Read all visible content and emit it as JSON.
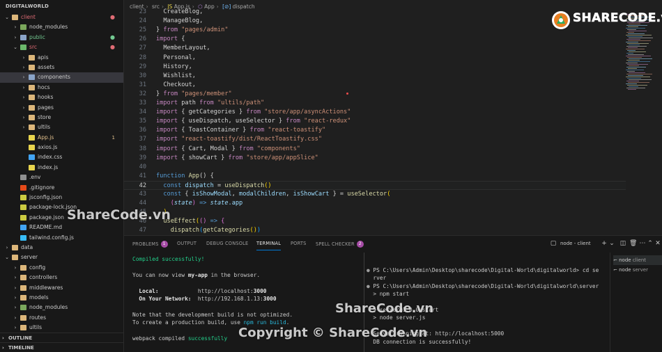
{
  "sidebar": {
    "header": "DIGITALWORLD",
    "items": [
      {
        "label": "client",
        "depth": 0,
        "chev": "⌄",
        "icon": "folder",
        "dot": "●",
        "color": "#e06c75"
      },
      {
        "label": "node_modules",
        "depth": 1,
        "chev": "›",
        "icon": "folder-node"
      },
      {
        "label": "public",
        "depth": 1,
        "chev": "›",
        "icon": "folder-special",
        "dot": "●",
        "color": "#73c991"
      },
      {
        "label": "src",
        "depth": 1,
        "chev": "⌄",
        "icon": "folder-src",
        "dot": "●",
        "color": "#e06c75"
      },
      {
        "label": "apis",
        "depth": 2,
        "chev": "›",
        "icon": "folder"
      },
      {
        "label": "assets",
        "depth": 2,
        "chev": "›",
        "icon": "folder"
      },
      {
        "label": "components",
        "depth": 2,
        "chev": "›",
        "icon": "folder-special",
        "selected": true
      },
      {
        "label": "hocs",
        "depth": 2,
        "chev": "›",
        "icon": "folder"
      },
      {
        "label": "hooks",
        "depth": 2,
        "chev": "›",
        "icon": "folder"
      },
      {
        "label": "pages",
        "depth": 2,
        "chev": "›",
        "icon": "folder"
      },
      {
        "label": "store",
        "depth": 2,
        "chev": "›",
        "icon": "folder"
      },
      {
        "label": "ultils",
        "depth": 2,
        "chev": "›",
        "icon": "folder"
      },
      {
        "label": "App.js",
        "depth": 2,
        "icon": "f-js",
        "badge": "1",
        "color": "#e2c08d"
      },
      {
        "label": "axios.js",
        "depth": 2,
        "icon": "f-js"
      },
      {
        "label": "index.css",
        "depth": 2,
        "icon": "f-css"
      },
      {
        "label": "index.js",
        "depth": 2,
        "icon": "f-js"
      },
      {
        "label": ".env",
        "depth": 1,
        "icon": "f-env"
      },
      {
        "label": ".gitignore",
        "depth": 1,
        "icon": "f-git"
      },
      {
        "label": "jsconfig.json",
        "depth": 1,
        "icon": "f-json"
      },
      {
        "label": "package-lock.json",
        "depth": 1,
        "icon": "f-json"
      },
      {
        "label": "package.json",
        "depth": 1,
        "icon": "f-json"
      },
      {
        "label": "README.md",
        "depth": 1,
        "icon": "f-md"
      },
      {
        "label": "tailwind.config.js",
        "depth": 1,
        "icon": "f-tw"
      },
      {
        "label": "data",
        "depth": 0,
        "chev": "›",
        "icon": "folder"
      },
      {
        "label": "server",
        "depth": 0,
        "chev": "⌄",
        "icon": "folder"
      },
      {
        "label": "config",
        "depth": 1,
        "chev": "›",
        "icon": "folder"
      },
      {
        "label": "controllers",
        "depth": 1,
        "chev": "›",
        "icon": "folder"
      },
      {
        "label": "middlewares",
        "depth": 1,
        "chev": "›",
        "icon": "folder"
      },
      {
        "label": "models",
        "depth": 1,
        "chev": "›",
        "icon": "folder"
      },
      {
        "label": "node_modules",
        "depth": 1,
        "chev": "›",
        "icon": "folder-node"
      },
      {
        "label": "routes",
        "depth": 1,
        "chev": "›",
        "icon": "folder"
      },
      {
        "label": "ultils",
        "depth": 1,
        "chev": "›",
        "icon": "folder"
      }
    ],
    "outline": "OUTLINE",
    "timeline": "TIMELINE"
  },
  "breadcrumb": [
    "client",
    "src",
    "App.js",
    "App",
    "dispatch"
  ],
  "editor": {
    "lines": [
      {
        "n": "23",
        "tokens": [
          [
            "  CreateBlog,",
            "punc"
          ]
        ]
      },
      {
        "n": "24",
        "tokens": [
          [
            "  ManageBlog,",
            "punc"
          ]
        ]
      },
      {
        "n": "25",
        "tokens": [
          [
            "} ",
            "punc"
          ],
          [
            "from",
            "kw"
          ],
          [
            " \"pages/admin\"",
            "str"
          ]
        ]
      },
      {
        "n": "26",
        "tokens": [
          [
            "import",
            "kw"
          ],
          [
            " {",
            "punc"
          ]
        ]
      },
      {
        "n": "27",
        "tokens": [
          [
            "  MemberLayout,",
            "punc"
          ]
        ]
      },
      {
        "n": "28",
        "tokens": [
          [
            "  Personal,",
            "punc"
          ]
        ]
      },
      {
        "n": "29",
        "tokens": [
          [
            "  History,",
            "punc"
          ]
        ]
      },
      {
        "n": "30",
        "tokens": [
          [
            "  Wishlist,",
            "punc"
          ]
        ]
      },
      {
        "n": "31",
        "tokens": [
          [
            "  Checkout,",
            "punc"
          ]
        ]
      },
      {
        "n": "32",
        "tokens": [
          [
            "} ",
            "punc"
          ],
          [
            "from",
            "kw"
          ],
          [
            " \"pages/member\"",
            "str"
          ]
        ]
      },
      {
        "n": "33",
        "tokens": [
          [
            "import",
            "kw"
          ],
          [
            " path ",
            "punc"
          ],
          [
            "from",
            "kw"
          ],
          [
            " \"ultils/path\"",
            "str"
          ]
        ]
      },
      {
        "n": "34",
        "tokens": [
          [
            "import",
            "kw"
          ],
          [
            " { getCategories } ",
            "punc"
          ],
          [
            "from",
            "kw"
          ],
          [
            " \"store/app/asyncActions\"",
            "str"
          ]
        ]
      },
      {
        "n": "35",
        "tokens": [
          [
            "import",
            "kw"
          ],
          [
            " { useDispatch, useSelector } ",
            "punc"
          ],
          [
            "from",
            "kw"
          ],
          [
            " \"react-redux\"",
            "str"
          ]
        ]
      },
      {
        "n": "36",
        "tokens": [
          [
            "import",
            "kw"
          ],
          [
            " { ToastContainer } ",
            "punc"
          ],
          [
            "from",
            "kw"
          ],
          [
            " \"react-toastify\"",
            "str"
          ]
        ]
      },
      {
        "n": "37",
        "tokens": [
          [
            "import",
            "kw"
          ],
          [
            " \"react-toastify/dist/ReactToastify.css\"",
            "str"
          ]
        ]
      },
      {
        "n": "38",
        "tokens": [
          [
            "import",
            "kw"
          ],
          [
            " { Cart, Modal } ",
            "punc"
          ],
          [
            "from",
            "kw"
          ],
          [
            " \"components\"",
            "str"
          ]
        ]
      },
      {
        "n": "39",
        "tokens": [
          [
            "import",
            "kw"
          ],
          [
            " { showCart } ",
            "punc"
          ],
          [
            "from",
            "kw"
          ],
          [
            " \"store/app/appSlice\"",
            "str"
          ]
        ]
      },
      {
        "n": "40",
        "tokens": [
          [
            "",
            "punc"
          ]
        ]
      },
      {
        "n": "41",
        "tokens": [
          [
            "function",
            "kw2"
          ],
          [
            " App",
            "fn"
          ],
          [
            "() {",
            "punc"
          ]
        ]
      },
      {
        "n": "42",
        "tokens": [
          [
            "  const",
            "kw2"
          ],
          [
            " dispatch ",
            "var"
          ],
          [
            "= ",
            "punc"
          ],
          [
            "useDispatch",
            "fn"
          ],
          [
            "()",
            "brk2"
          ]
        ],
        "active": true
      },
      {
        "n": "43",
        "tokens": [
          [
            "  const",
            "kw2"
          ],
          [
            " { ",
            "punc"
          ],
          [
            "isShowModal",
            "var"
          ],
          [
            ", ",
            "punc"
          ],
          [
            "modalChildren",
            "var"
          ],
          [
            ", ",
            "punc"
          ],
          [
            "isShowCart",
            "var"
          ],
          [
            " } = ",
            "punc"
          ],
          [
            "useSelector",
            "fn"
          ],
          [
            "(",
            "brk2"
          ]
        ]
      },
      {
        "n": "44",
        "tokens": [
          [
            "    (",
            "brk"
          ],
          [
            "state",
            "ital"
          ],
          [
            ")",
            "brk"
          ],
          [
            " => ",
            "kw2"
          ],
          [
            "state",
            "ital"
          ],
          [
            ".app",
            "var"
          ]
        ]
      },
      {
        "n": "45",
        "tokens": [
          [
            "  )",
            "brk2"
          ]
        ]
      },
      {
        "n": "46",
        "tokens": [
          [
            "  useEffect",
            "fn"
          ],
          [
            "(",
            "brk2"
          ],
          [
            "()",
            "brk"
          ],
          [
            " => ",
            "kw2"
          ],
          [
            "{",
            "brk"
          ]
        ]
      },
      {
        "n": "47",
        "tokens": [
          [
            "    dispatch",
            "fn"
          ],
          [
            "(",
            "brk3"
          ],
          [
            "getCategories",
            "fn"
          ],
          [
            "()",
            "brk2"
          ],
          [
            ")",
            "brk3"
          ]
        ]
      }
    ]
  },
  "logo": {
    "text": "SHARECODE.vn"
  },
  "panel": {
    "tabs": [
      {
        "label": "PROBLEMS",
        "count": "1"
      },
      {
        "label": "OUTPUT"
      },
      {
        "label": "DEBUG CONSOLE"
      },
      {
        "label": "TERMINAL",
        "active": true
      },
      {
        "label": "PORTS"
      },
      {
        "label": "SPELL CHECKER",
        "count": "2"
      }
    ],
    "terminal_title": "node - client",
    "left_terminal": [
      [
        [
          "Compiled successfully!",
          "t-green"
        ]
      ],
      [
        [
          "",
          ""
        ]
      ],
      [
        [
          "You can now view ",
          ""
        ],
        [
          "my-app",
          "t-white"
        ],
        [
          " in the browser.",
          ""
        ]
      ],
      [
        [
          "",
          ""
        ]
      ],
      [
        [
          "  ",
          ""
        ],
        [
          "Local:",
          "t-white"
        ],
        [
          "            http://localhost:",
          ""
        ],
        [
          "3000",
          "t-white"
        ]
      ],
      [
        [
          "  ",
          ""
        ],
        [
          "On Your Network:",
          "t-white"
        ],
        [
          "  http://192.168.1.13:",
          ""
        ],
        [
          "3000",
          "t-white"
        ]
      ],
      [
        [
          "",
          ""
        ]
      ],
      [
        [
          "Note that the development build is not optimized.",
          ""
        ]
      ],
      [
        [
          "To create a production build, use ",
          ""
        ],
        [
          "npm run build",
          "t-cyan"
        ],
        [
          ".",
          ""
        ]
      ],
      [
        [
          "",
          ""
        ]
      ],
      [
        [
          "webpack compiled ",
          ""
        ],
        [
          "successfully",
          "t-green"
        ]
      ]
    ],
    "right_terminal": [
      [
        [
          "● ",
          "t-dim"
        ],
        [
          "PS C:\\Users\\Admin\\Desktop\\sharecode\\Digital-World\\digitalworld> cd se",
          ""
        ]
      ],
      [
        [
          "  rver",
          ""
        ]
      ],
      [
        [
          "● ",
          "t-dim"
        ],
        [
          "PS C:\\Users\\Admin\\Desktop\\sharecode\\Digital-World\\digitalworld\\server",
          ""
        ]
      ],
      [
        [
          "  > npm start",
          ""
        ]
      ],
      [
        [
          "",
          ""
        ]
      ],
      [
        [
          "  > server@1.0.0 start",
          ""
        ]
      ],
      [
        [
          "  > node server.js",
          ""
        ]
      ],
      [
        [
          "",
          ""
        ]
      ],
      [
        [
          "  Server running at: http://localhost:5000",
          ""
        ]
      ],
      [
        [
          "  DB connection is successfully!",
          ""
        ]
      ]
    ],
    "terminal_list": [
      {
        "name": "node",
        "tag": "client",
        "selected": true
      },
      {
        "name": "node",
        "tag": "server"
      }
    ]
  },
  "watermarks": {
    "center": "ShareCode.vn",
    "panel": "ShareCode.vn",
    "copyright": "Copyright © ShareCode.vn"
  }
}
